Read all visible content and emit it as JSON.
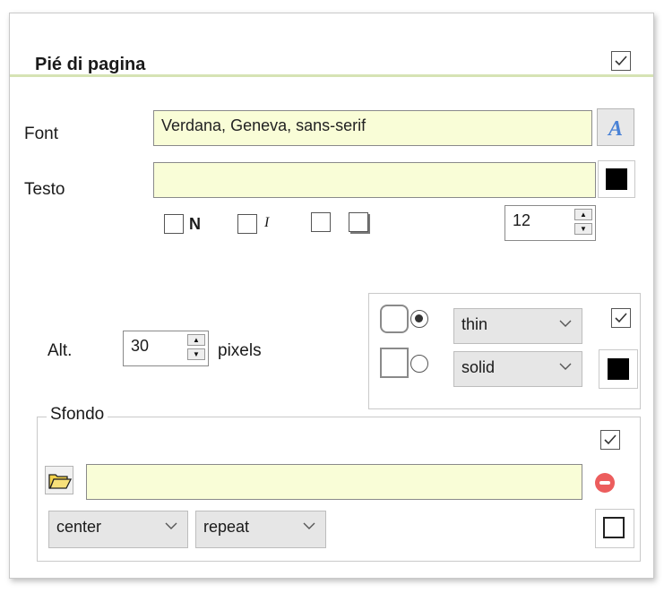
{
  "header": {
    "title": "Pié di pagina",
    "enabled": true
  },
  "font": {
    "label": "Font",
    "value": "Verdana, Geneva, sans-serif",
    "icon": "font-style-icon"
  },
  "testo": {
    "label": "Testo",
    "value": "",
    "color": "#000000",
    "bold_label": "N",
    "italic_label": "I",
    "size": "12"
  },
  "alt": {
    "label": "Alt.",
    "value": "30",
    "unit": "pixels"
  },
  "border": {
    "width": "thin",
    "style": "solid",
    "enabled": true,
    "color": "#000000",
    "radius_mode": "rounded"
  },
  "sfondo": {
    "legend": "Sfondo",
    "enabled": true,
    "image_path": "",
    "position": "center",
    "repeat": "repeat",
    "color": "#ffffff"
  }
}
